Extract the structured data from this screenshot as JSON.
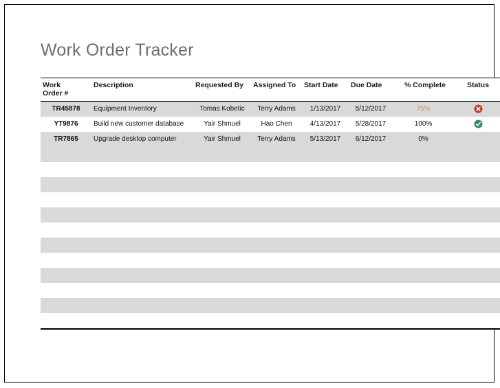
{
  "page": {
    "title": "Work Order Tracker",
    "title_color": "#6c6f73",
    "background": "#ffffff",
    "border_color": "#000000"
  },
  "table": {
    "shaded_row_color": "#d9d9d9",
    "plain_row_color": "#ffffff",
    "rule_color": "#000000",
    "columns": [
      {
        "key": "work_order",
        "label": "Work\nOrder #",
        "label_line1": "Work",
        "label_line2": "Order #"
      },
      {
        "key": "description",
        "label": "Description"
      },
      {
        "key": "requested_by",
        "label": "Requested By"
      },
      {
        "key": "assigned_to",
        "label": "Assigned To"
      },
      {
        "key": "start_date",
        "label": "Start Date"
      },
      {
        "key": "due_date",
        "label": "Due Date"
      },
      {
        "key": "pct_complete",
        "label": "% Complete"
      },
      {
        "key": "status",
        "label": "Status"
      }
    ],
    "rows": [
      {
        "work_order": "TR45878",
        "description": "Equipment Inventory",
        "requested_by": "Tomas Kobetic",
        "assigned_to": "Terry Adams",
        "start_date": "1/13/2017",
        "due_date": "5/12/2017",
        "pct_complete": "75%",
        "pct_color": "#d98a4e",
        "status_icon": "error-circle-icon",
        "status_color": "#c0392b",
        "shaded": true
      },
      {
        "work_order": "YT9876",
        "description": "Build new customer database",
        "requested_by": "Yair Shmuel",
        "assigned_to": "Hao Chen",
        "start_date": "4/13/2017",
        "due_date": "5/28/2017",
        "pct_complete": "100%",
        "pct_color": "#111111",
        "status_icon": "check-circle-icon",
        "status_color": "#2e8b72",
        "shaded": false
      },
      {
        "work_order": "TR7865",
        "description": "Upgrade desktop computer",
        "requested_by": "Yair Shmuel",
        "assigned_to": "Terry Adams",
        "start_date": "5/13/2017",
        "due_date": "6/12/2017",
        "pct_complete": "0%",
        "pct_color": "#111111",
        "status_icon": "",
        "status_color": "",
        "shaded": true
      }
    ],
    "empty_row_count": 12
  }
}
